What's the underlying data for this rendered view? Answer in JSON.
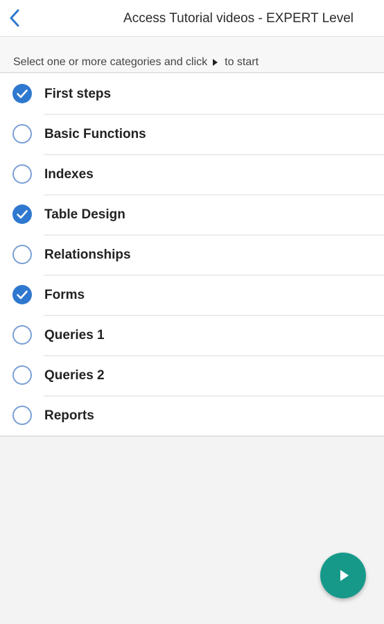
{
  "header": {
    "back_icon": "chevron-left-icon",
    "title": "Access Tutorial videos - EXPERT Level"
  },
  "instructions": {
    "before": "Select one or more categories and click",
    "play_icon": "play-small-icon",
    "after": "to start"
  },
  "categories": [
    {
      "label": "First steps",
      "checked": true
    },
    {
      "label": "Basic Functions",
      "checked": false
    },
    {
      "label": "Indexes",
      "checked": false
    },
    {
      "label": "Table Design",
      "checked": true
    },
    {
      "label": "Relationships",
      "checked": false
    },
    {
      "label": "Forms",
      "checked": true
    },
    {
      "label": "Queries 1",
      "checked": false
    },
    {
      "label": "Queries 2",
      "checked": false
    },
    {
      "label": "Reports",
      "checked": false
    }
  ],
  "start_button": {
    "icon": "play-icon"
  },
  "colors": {
    "accent": "#2f78cf",
    "fab": "#17998a",
    "background": "#f3f3f3"
  }
}
